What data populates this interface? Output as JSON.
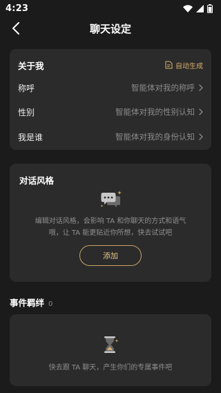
{
  "status_bar": {
    "time": "4:23",
    "icons": [
      "wifi-icon",
      "signal-icon",
      "battery-icon"
    ]
  },
  "header": {
    "title": "聊天设定",
    "back_icon": "chevron-left-icon"
  },
  "about_me": {
    "title": "关于我",
    "auto_generate_label": "自动生成",
    "auto_generate_icon": "document-icon",
    "rows": [
      {
        "label": "称呼",
        "value": "智能体对我的称呼"
      },
      {
        "label": "性别",
        "value": "智能体对我的性别认知"
      },
      {
        "label": "我是谁",
        "value": "智能体对我的身份认知"
      }
    ]
  },
  "dialogue_style": {
    "title": "对话风格",
    "icon": "chat-bubbles-icon",
    "description_line1": "编辑对话风格，会影响 TA 和你聊天的方式和语气",
    "description_line2": "哦，让 TA 能更贴近你所想，快去试试吧",
    "add_label": "添加"
  },
  "events": {
    "title": "事件羁绊",
    "count": "0",
    "icon": "hourglass-icon",
    "empty_text": "快去跟 TA 聊天，产生你们的专属事件吧"
  },
  "colors": {
    "background": "#1b1b1b",
    "card": "#2b2b2b",
    "accent_gold": "#d3ad6b",
    "muted_text": "#8b8b8b"
  }
}
